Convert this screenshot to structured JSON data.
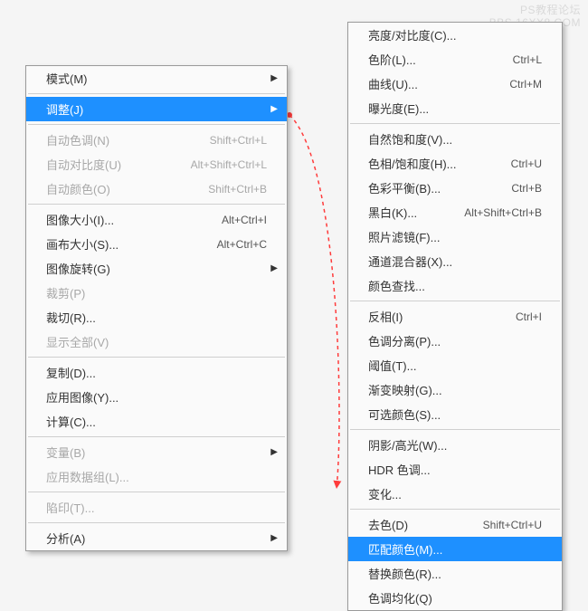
{
  "watermark": {
    "line1": "PS教程论坛",
    "line2": "BBS.16XX8.COM"
  },
  "leftMenu": [
    {
      "type": "item",
      "label": "模式(M)",
      "submenu": true
    },
    {
      "type": "sep"
    },
    {
      "type": "item",
      "label": "调整(J)",
      "submenu": true,
      "highlight": true
    },
    {
      "type": "sep"
    },
    {
      "type": "item",
      "label": "自动色调(N)",
      "shortcut": "Shift+Ctrl+L",
      "disabled": true
    },
    {
      "type": "item",
      "label": "自动对比度(U)",
      "shortcut": "Alt+Shift+Ctrl+L",
      "disabled": true
    },
    {
      "type": "item",
      "label": "自动颜色(O)",
      "shortcut": "Shift+Ctrl+B",
      "disabled": true
    },
    {
      "type": "sep"
    },
    {
      "type": "item",
      "label": "图像大小(I)...",
      "shortcut": "Alt+Ctrl+I"
    },
    {
      "type": "item",
      "label": "画布大小(S)...",
      "shortcut": "Alt+Ctrl+C"
    },
    {
      "type": "item",
      "label": "图像旋转(G)",
      "submenu": true
    },
    {
      "type": "item",
      "label": "裁剪(P)",
      "disabled": true
    },
    {
      "type": "item",
      "label": "裁切(R)..."
    },
    {
      "type": "item",
      "label": "显示全部(V)",
      "disabled": true
    },
    {
      "type": "sep"
    },
    {
      "type": "item",
      "label": "复制(D)..."
    },
    {
      "type": "item",
      "label": "应用图像(Y)..."
    },
    {
      "type": "item",
      "label": "计算(C)..."
    },
    {
      "type": "sep"
    },
    {
      "type": "item",
      "label": "变量(B)",
      "submenu": true,
      "disabled": true
    },
    {
      "type": "item",
      "label": "应用数据组(L)...",
      "disabled": true
    },
    {
      "type": "sep"
    },
    {
      "type": "item",
      "label": "陷印(T)...",
      "disabled": true
    },
    {
      "type": "sep"
    },
    {
      "type": "item",
      "label": "分析(A)",
      "submenu": true
    }
  ],
  "rightMenu": [
    {
      "type": "item",
      "label": "亮度/对比度(C)..."
    },
    {
      "type": "item",
      "label": "色阶(L)...",
      "shortcut": "Ctrl+L"
    },
    {
      "type": "item",
      "label": "曲线(U)...",
      "shortcut": "Ctrl+M"
    },
    {
      "type": "item",
      "label": "曝光度(E)..."
    },
    {
      "type": "sep"
    },
    {
      "type": "item",
      "label": "自然饱和度(V)..."
    },
    {
      "type": "item",
      "label": "色相/饱和度(H)...",
      "shortcut": "Ctrl+U"
    },
    {
      "type": "item",
      "label": "色彩平衡(B)...",
      "shortcut": "Ctrl+B"
    },
    {
      "type": "item",
      "label": "黑白(K)...",
      "shortcut": "Alt+Shift+Ctrl+B"
    },
    {
      "type": "item",
      "label": "照片滤镜(F)..."
    },
    {
      "type": "item",
      "label": "通道混合器(X)..."
    },
    {
      "type": "item",
      "label": "颜色查找..."
    },
    {
      "type": "sep"
    },
    {
      "type": "item",
      "label": "反相(I)",
      "shortcut": "Ctrl+I"
    },
    {
      "type": "item",
      "label": "色调分离(P)..."
    },
    {
      "type": "item",
      "label": "阈值(T)..."
    },
    {
      "type": "item",
      "label": "渐变映射(G)..."
    },
    {
      "type": "item",
      "label": "可选颜色(S)..."
    },
    {
      "type": "sep"
    },
    {
      "type": "item",
      "label": "阴影/高光(W)..."
    },
    {
      "type": "item",
      "label": "HDR 色调..."
    },
    {
      "type": "item",
      "label": "变化..."
    },
    {
      "type": "sep"
    },
    {
      "type": "item",
      "label": "去色(D)",
      "shortcut": "Shift+Ctrl+U"
    },
    {
      "type": "item",
      "label": "匹配颜色(M)...",
      "highlight": true
    },
    {
      "type": "item",
      "label": "替换颜色(R)..."
    },
    {
      "type": "item",
      "label": "色调均化(Q)"
    }
  ],
  "connector": {
    "color": "#ff3b3b"
  }
}
